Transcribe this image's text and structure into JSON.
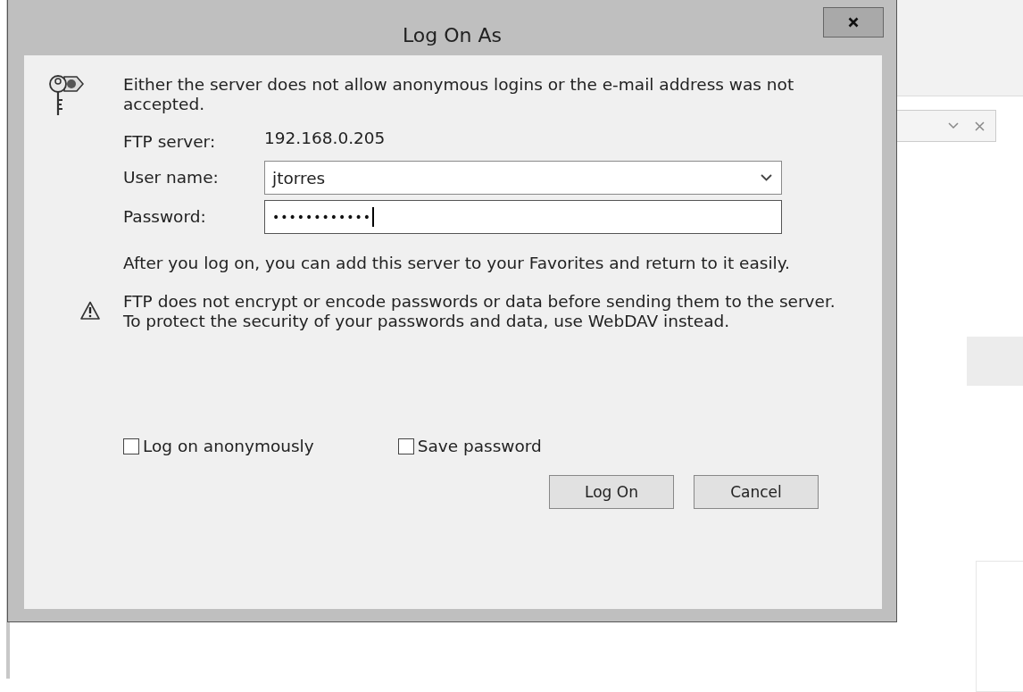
{
  "window": {
    "title": "Log On As"
  },
  "message": "Either the server does not allow anonymous logins or the e-mail address was not accepted.",
  "server": {
    "label": "FTP server:",
    "value": "192.168.0.205"
  },
  "user_name": {
    "label": "User name:",
    "value": "jtorres"
  },
  "password": {
    "label": "Password:",
    "value": "••••••••••••",
    "focused": true
  },
  "info": "After you log on, you can add this server to your Favorites and return to it easily.",
  "warning": "FTP does not encrypt or encode passwords or data before sending them to the server.  To protect the security of your passwords and data, use WebDAV instead.",
  "checkboxes": [
    {
      "label": "Log on anonymously",
      "checked": false
    },
    {
      "label": "Save password",
      "checked": false
    }
  ],
  "buttons": [
    "Log On",
    "Cancel"
  ]
}
